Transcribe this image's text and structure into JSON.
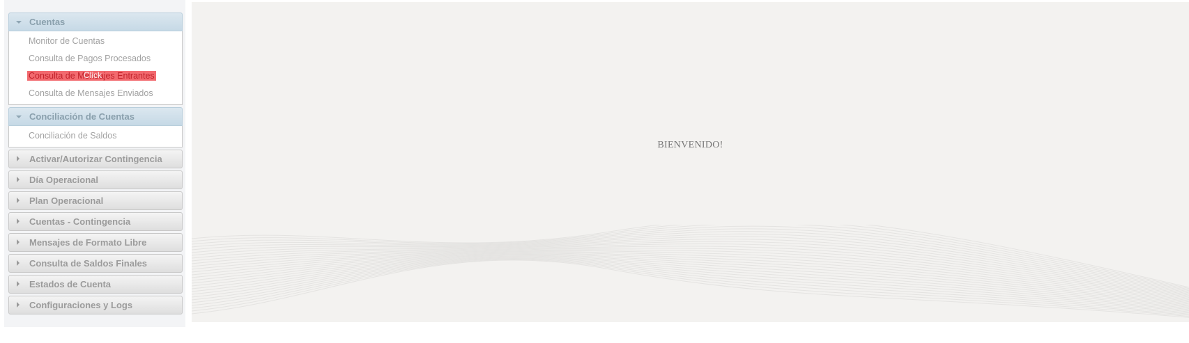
{
  "sidebar": {
    "sections": [
      {
        "label": "Cuentas",
        "open": true,
        "items": [
          {
            "label": "Monitor de Cuentas"
          },
          {
            "label": "Consulta de Pagos Procesados"
          },
          {
            "label": "Consulta de Mensajes Entrantes",
            "highlighted": true,
            "overlay": "Click"
          },
          {
            "label": "Consulta de Mensajes Enviados"
          }
        ]
      },
      {
        "label": "Conciliación de Cuentas",
        "open": true,
        "items": [
          {
            "label": "Conciliación de Saldos"
          }
        ]
      },
      {
        "label": "Activar/Autorizar Contingencia",
        "open": false
      },
      {
        "label": "Día Operacional",
        "open": false
      },
      {
        "label": "Plan Operacional",
        "open": false
      },
      {
        "label": "Cuentas - Contingencia",
        "open": false
      },
      {
        "label": "Mensajes de Formato Libre",
        "open": false
      },
      {
        "label": "Consulta de Saldos Finales",
        "open": false
      },
      {
        "label": "Estados de Cuenta",
        "open": false
      },
      {
        "label": "Configuraciones y Logs",
        "open": false
      }
    ]
  },
  "main": {
    "welcome_text": "BIENVENIDO!"
  },
  "colors": {
    "highlight_bg": "#f26a6f",
    "highlight_text": "#c2222b",
    "open_header": "#c6d9e6",
    "main_bg": "#f3f2f0"
  }
}
